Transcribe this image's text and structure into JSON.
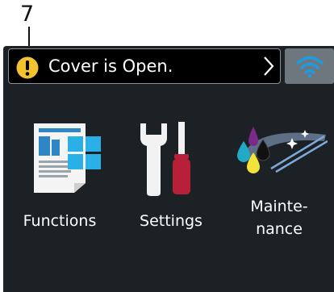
{
  "callout": {
    "number": "7"
  },
  "status": {
    "icon": "warning-icon",
    "message": "Cover is Open.",
    "chevron": "chevron-right-icon",
    "warning_color": "#f2c230"
  },
  "wifi": {
    "icon": "wifi-icon",
    "color": "#1e9be0"
  },
  "tiles": [
    {
      "icon": "functions-icon",
      "label": "Functions"
    },
    {
      "icon": "settings-icon",
      "label": "Settings"
    },
    {
      "icon": "maintenance-icon",
      "label_line1": "Mainte-",
      "label_line2": "nance"
    }
  ]
}
